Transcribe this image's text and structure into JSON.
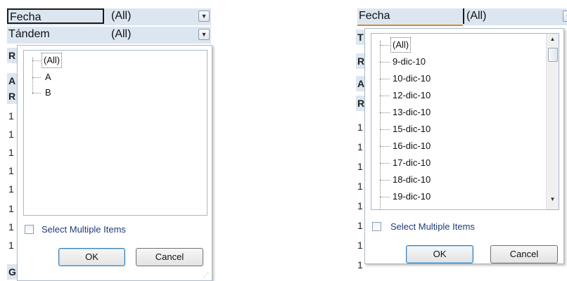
{
  "left_panel": {
    "filters": [
      {
        "label": "Fecha",
        "value": "(All)"
      },
      {
        "label": "Tándem",
        "value": "(All)"
      }
    ],
    "row_stubs": [
      "R",
      "A",
      "R",
      "1",
      "1",
      "1",
      "1",
      "1",
      "1",
      "1",
      "1",
      "G"
    ],
    "tree_items": [
      "(All)",
      "A",
      "B"
    ],
    "select_multiple_label": "Select Multiple Items",
    "ok_label": "OK",
    "cancel_label": "Cancel"
  },
  "right_panel": {
    "filters": [
      {
        "label": "Fecha",
        "value": "(All)"
      }
    ],
    "row_stubs": [
      "T",
      "R",
      "A",
      "R",
      "1",
      "1",
      "1",
      "1",
      "1",
      "1",
      "1",
      "1"
    ],
    "tree_items": [
      "(All)",
      "9-dic-10",
      "10-dic-10",
      "12-dic-10",
      "13-dic-10",
      "15-dic-10",
      "16-dic-10",
      "17-dic-10",
      "18-dic-10",
      "19-dic-10"
    ],
    "select_multiple_label": "Select Multiple Items",
    "ok_label": "OK",
    "cancel_label": "Cancel"
  },
  "icons": {
    "dropdown_arrow": "▼",
    "scroll_up": "▲",
    "scroll_down": "▼"
  },
  "colors": {
    "header_bg": "#dce6f1",
    "link_text": "#1f3a7a"
  }
}
